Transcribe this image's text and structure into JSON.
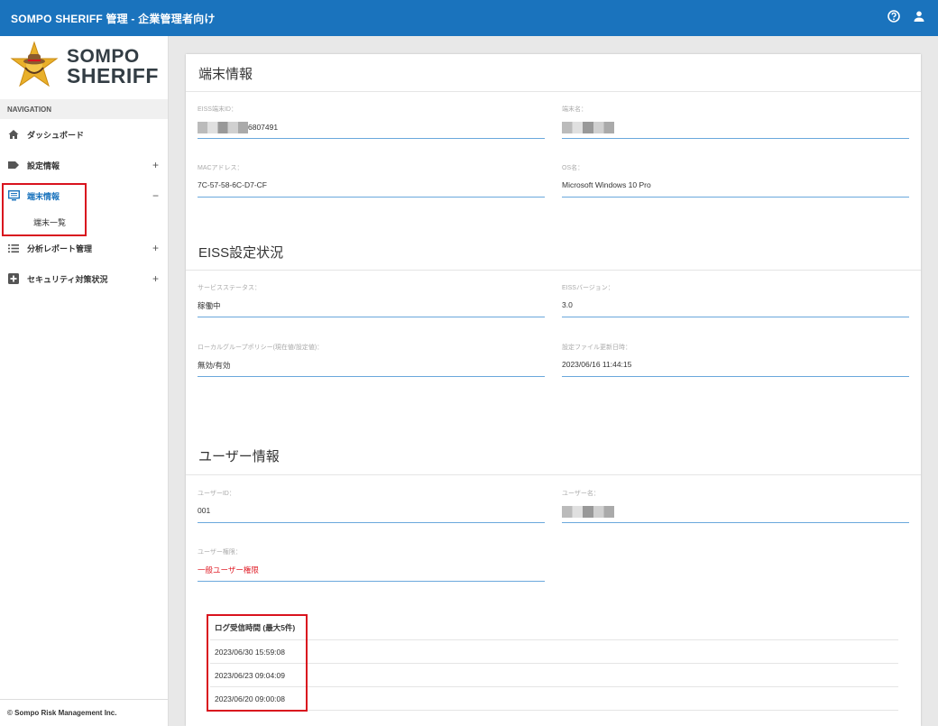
{
  "topbar": {
    "title": "SOMPO SHERIFF 管理 - 企業管理者向け",
    "icons": [
      "help-icon",
      "user-icon"
    ],
    "color": "#1a73bd"
  },
  "sidebar": {
    "logo": {
      "line1": "SOMPO",
      "line2": "SHERIFF"
    },
    "nav_header": "NAVIGATION",
    "items": [
      {
        "label": "ダッシュボード",
        "icon": "home-icon",
        "expand": ""
      },
      {
        "label": "設定情報",
        "icon": "tag-icon",
        "expand": "+"
      },
      {
        "label": "端末情報",
        "icon": "monitor-icon",
        "expand": "−",
        "active": true,
        "children": [
          {
            "label": "端末一覧"
          }
        ]
      },
      {
        "label": "分析レポート管理",
        "icon": "list-icon",
        "expand": "+"
      },
      {
        "label": "セキュリティ対策状況",
        "icon": "plus-box-icon",
        "expand": "+"
      }
    ],
    "footer": "© Sompo Risk Management Inc."
  },
  "main": {
    "device": {
      "title": "端末情報",
      "fields": {
        "id": {
          "label": "EISS端末ID：",
          "value": "6807491"
        },
        "name": {
          "label": "端末名：",
          "value": ""
        },
        "mac": {
          "label": "MACアドレス：",
          "value": "7C-57-58-6C-D7-CF"
        },
        "os": {
          "label": "OS名：",
          "value": "Microsoft Windows 10 Pro"
        }
      }
    },
    "eiss": {
      "title": "EISS設定状況",
      "fields": {
        "status": {
          "label": "サービスステータス：",
          "value": "稼働中"
        },
        "version": {
          "label": "EISSバージョン：",
          "value": "3.0"
        },
        "policy": {
          "label": "ローカルグループポリシー(現在値/設定値)：",
          "value": "無効/有効"
        },
        "updated": {
          "label": "設定ファイル更新日時：",
          "value": "2023/06/16 11:44:15"
        }
      }
    },
    "user": {
      "title": "ユーザー情報",
      "fields": {
        "uid": {
          "label": "ユーザーID：",
          "value": "001"
        },
        "uname": {
          "label": "ユーザー名：",
          "value": ""
        },
        "role": {
          "label": "ユーザー権限：",
          "value": "一般ユーザー権限",
          "color": "#e0202a"
        }
      }
    },
    "log": {
      "header": "ログ受信時間 (最大5件)",
      "rows": [
        "2023/06/30 15:59:08",
        "2023/06/23 09:04:09",
        "2023/06/20 09:00:08"
      ]
    }
  },
  "highlight_color": "#d9131e"
}
